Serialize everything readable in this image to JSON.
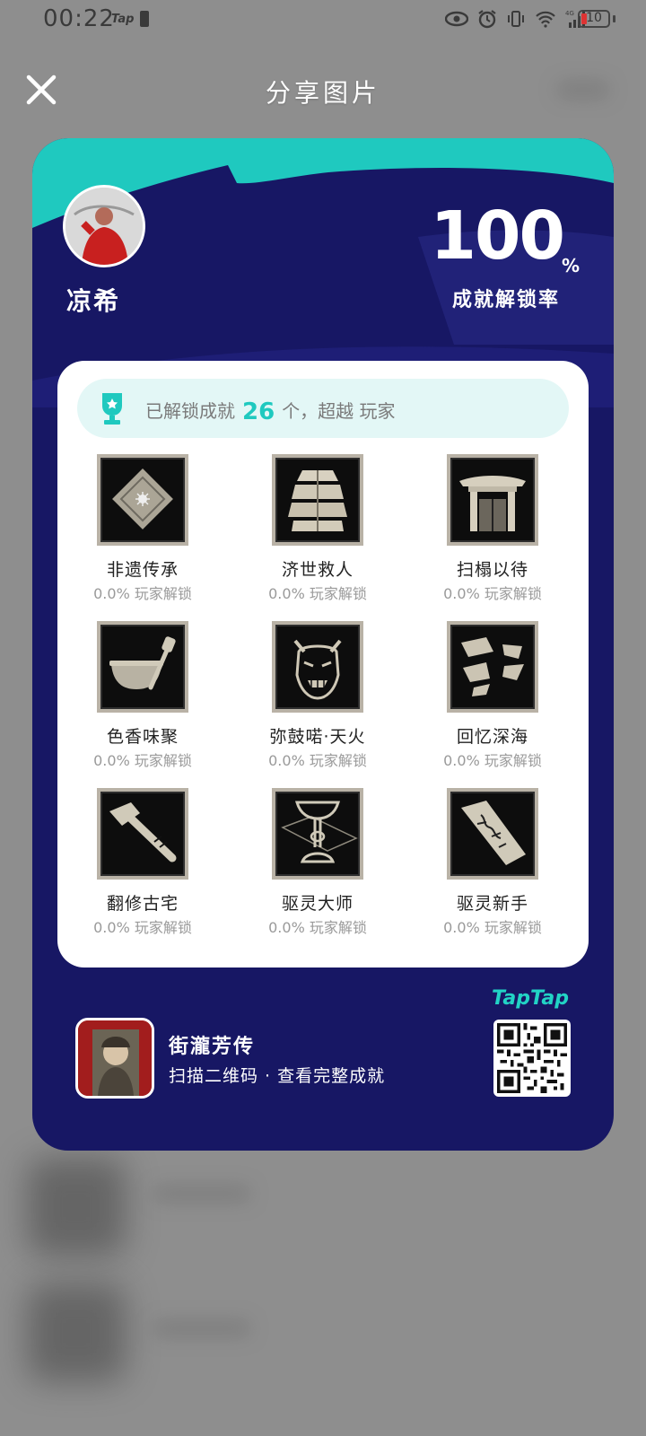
{
  "status_bar": {
    "time": "00:22",
    "tap_label": "Tap",
    "network": "4G",
    "battery": "10"
  },
  "header": {
    "title": "分享图片"
  },
  "card": {
    "username": "凉希",
    "unlock_rate_value": "100",
    "unlock_rate_unit": "%",
    "unlock_rate_label": "成就解锁率",
    "summary_prefix": "已解锁成就",
    "summary_count": "26",
    "summary_suffix": "个，超越  玩家",
    "achievements": [
      {
        "name": "非遗传承",
        "rate": "0.0% 玩家解锁",
        "icon": "diamond-icon"
      },
      {
        "name": "济世救人",
        "rate": "0.0% 玩家解锁",
        "icon": "rice-bags-icon"
      },
      {
        "name": "扫榻以待",
        "rate": "0.0% 玩家解锁",
        "icon": "gate-icon"
      },
      {
        "name": "色香味聚",
        "rate": "0.0% 玩家解锁",
        "icon": "wok-icon"
      },
      {
        "name": "弥鼓喏·天火",
        "rate": "0.0% 玩家解锁",
        "icon": "demon-mask-icon"
      },
      {
        "name": "回忆深海",
        "rate": "0.0% 玩家解锁",
        "icon": "shards-icon"
      },
      {
        "name": "翻修古宅",
        "rate": "0.0% 玩家解锁",
        "icon": "hammer-icon"
      },
      {
        "name": "驱灵大师",
        "rate": "0.0% 玩家解锁",
        "icon": "goblet-icon"
      },
      {
        "name": "驱灵新手",
        "rate": "0.0% 玩家解锁",
        "icon": "talisman-icon"
      }
    ],
    "game_name": "街瀧芳传",
    "game_tagline": "扫描二维码 · 查看完整成就",
    "platform": "TapTap"
  },
  "colors": {
    "card_bg": "#171764",
    "accent_teal": "#1fc9bf",
    "panel_bg": "#ffffff"
  }
}
